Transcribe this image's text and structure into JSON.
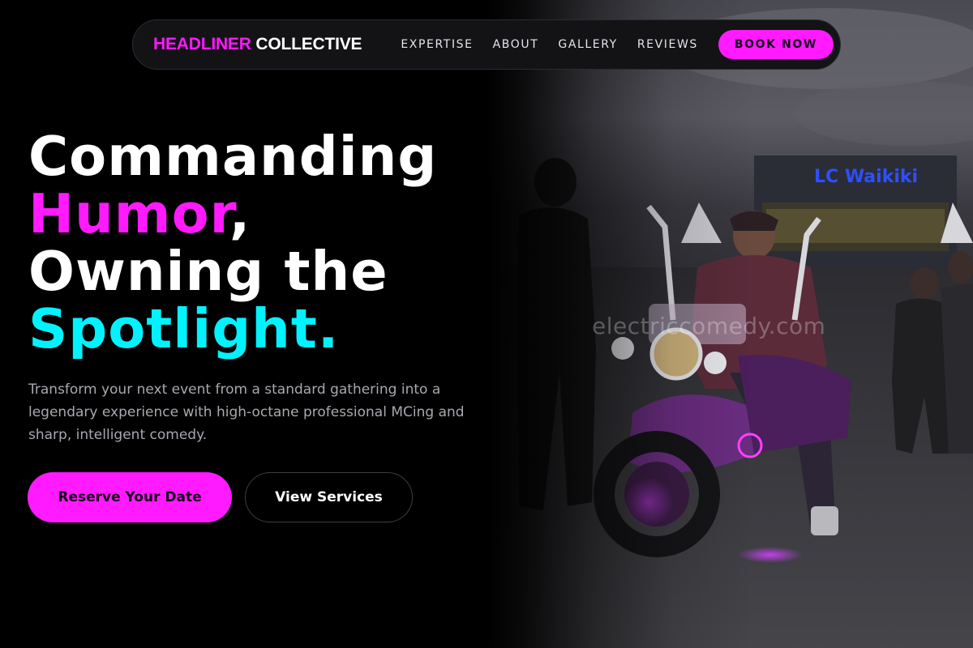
{
  "brand": {
    "accent": "HEADLINER",
    "rest": " COLLECTIVE"
  },
  "nav": {
    "items": [
      "EXPERTISE",
      "ABOUT",
      "GALLERY",
      "REVIEWS"
    ],
    "cta": "BOOK NOW"
  },
  "hero": {
    "headline": {
      "line1": "Commanding",
      "line2_highlight": "Humor",
      "line2_rest": ",",
      "line3": "Owning the",
      "line4": "Spotlight."
    },
    "subtitle": "Transform your next event from a standard gathering into a legendary experience with high-octane professional MCing and sharp, intelligent comedy.",
    "primary_cta": "Reserve Your Date",
    "secondary_cta": "View Services",
    "image": {
      "subject": "man in sunglasses riding a purple-lit motorcycle in a city street at dusk",
      "sign_text": "LC Waikiki",
      "watermark": "electriccomedy.com"
    }
  },
  "colors": {
    "magenta": "#ff1aff",
    "cyan": "#00f3ff",
    "background": "#000000",
    "nav_bg": "#131316"
  }
}
